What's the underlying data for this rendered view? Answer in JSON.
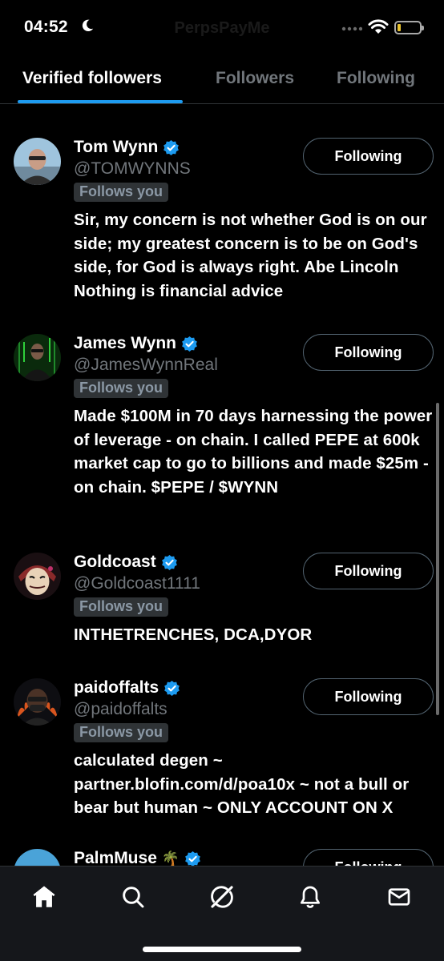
{
  "status_bar": {
    "time": "04:52",
    "ghost_title": "PerpsPayMe"
  },
  "tabs": [
    {
      "label": "Verified followers",
      "active": true
    },
    {
      "label": "Followers",
      "active": false
    },
    {
      "label": "Following",
      "active": false
    }
  ],
  "users": [
    {
      "name": "Tom Wynn",
      "handle": "@TOMWYNNS",
      "follows_you": "Follows you",
      "bio": "Sir, my concern is not whether God is on our side; my greatest concern is to be on God's side, for God is always right. Abe Lincoln Nothing is financial advice",
      "button": "Following",
      "avatar_icon": "person-photo"
    },
    {
      "name": "James Wynn",
      "handle": "@JamesWynnReal",
      "follows_you": "Follows you",
      "bio": "Made $100M in 70 days harnessing the power of leverage - on chain. I called PEPE at 600k market cap to go to billions and made $25m - on chain. $PEPE / $WYNN",
      "button": "Following",
      "avatar_icon": "matrix-person"
    },
    {
      "name": "Goldcoast",
      "handle": "@Goldcoast1111",
      "follows_you": "Follows you",
      "bio": "INTHETRENCHES, DCA,DYOR",
      "button": "Following",
      "avatar_icon": "mask"
    },
    {
      "name": "paidoffalts",
      "handle": "@paidoffalts",
      "follows_you": "Follows you",
      "bio": "calculated degen ~ partner.blofin.com/d/poa10x ~ not a bull or bear but human ~ ONLY ACCOUNT ON X",
      "button": "Following",
      "avatar_icon": "cartoon-character"
    },
    {
      "name": "PalmMuse",
      "name_emoji": "🌴",
      "handle": "",
      "follows_you": "",
      "bio": "",
      "button": "Following",
      "avatar_icon": "beach-photo"
    }
  ],
  "bottom_nav": [
    {
      "icon": "home-icon",
      "active": true
    },
    {
      "icon": "search-icon",
      "active": false
    },
    {
      "icon": "grok-icon",
      "active": false
    },
    {
      "icon": "bell-icon",
      "active": false
    },
    {
      "icon": "mail-icon",
      "active": false
    }
  ],
  "colors": {
    "accent": "#1d9bf0",
    "background": "#000000",
    "muted_text": "#71767b"
  }
}
